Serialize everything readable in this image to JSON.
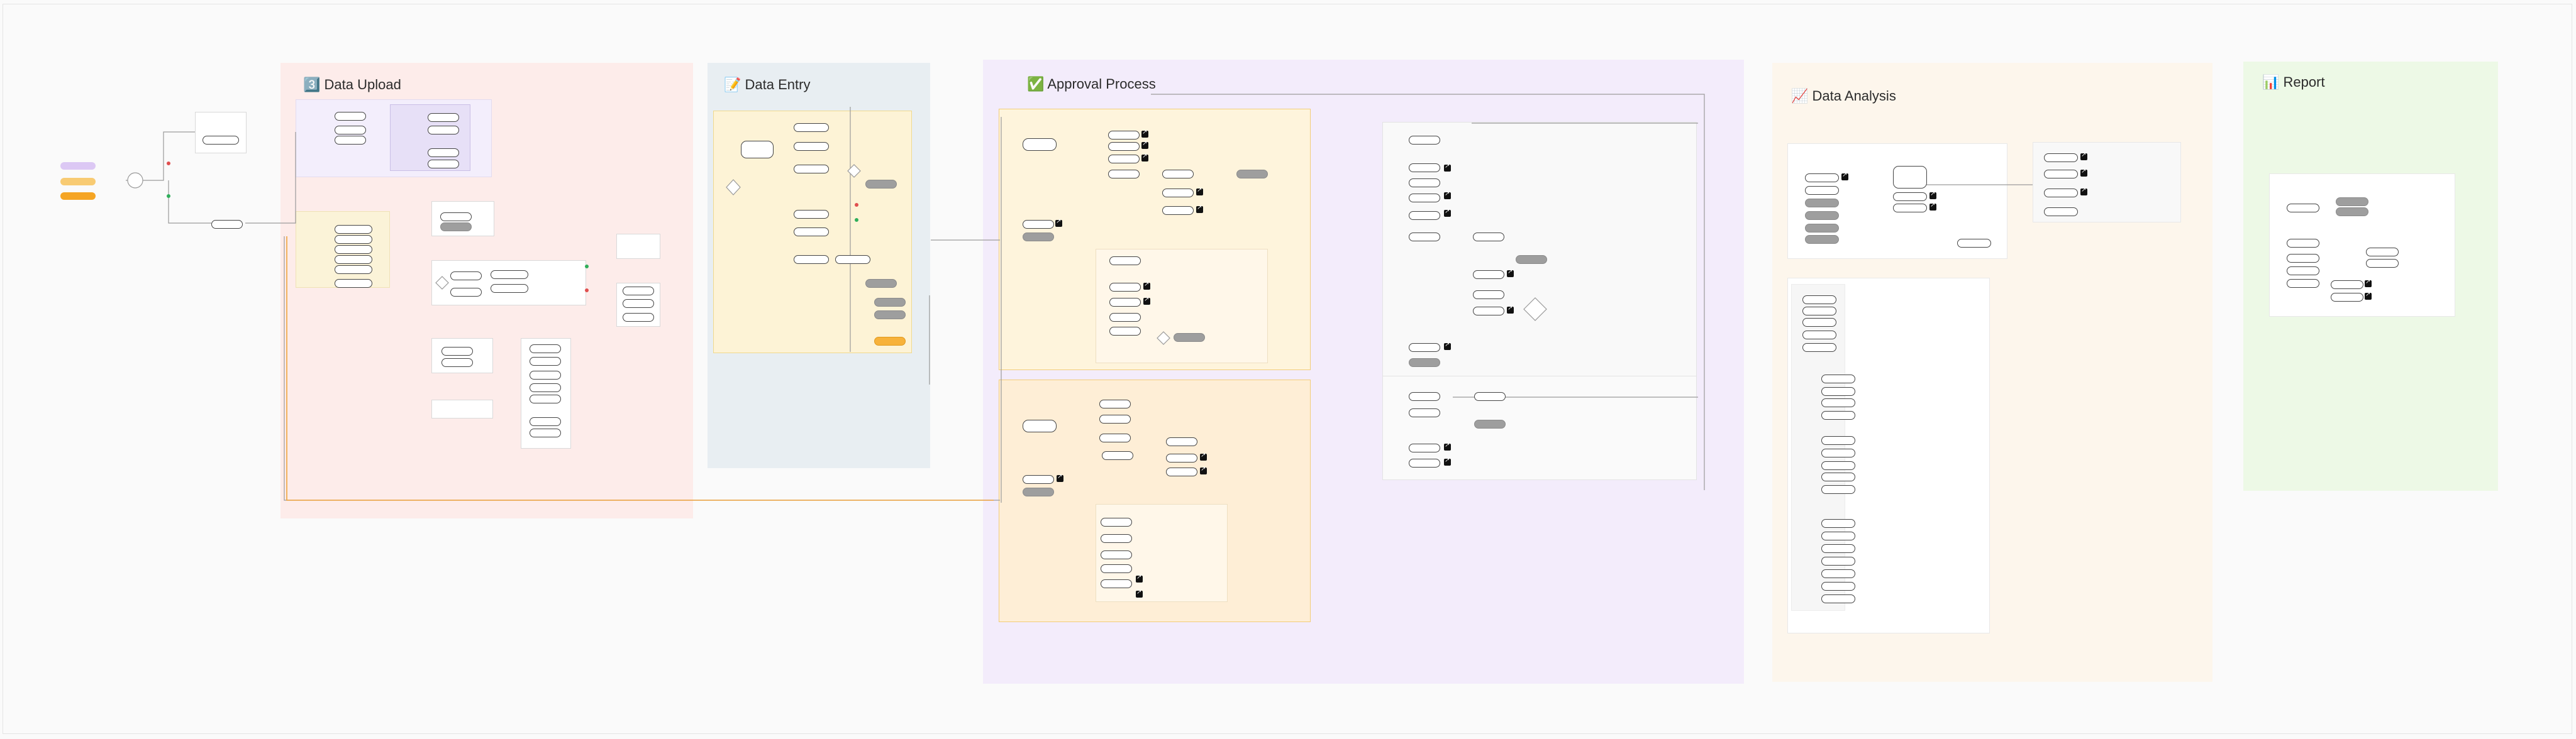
{
  "canvas": {
    "label": ""
  },
  "colors": {
    "upload_bg": "#fdecea",
    "entry_bg": "#e8eef2",
    "approval_bg": "#f3ecfb",
    "analysis_bg": "#fdf6ec",
    "report_bg": "#edf9e6",
    "grey_node": "#9e9e9e",
    "orange_node": "#f7b23b",
    "legend_purple": "#dcc8f4",
    "legend_orange_light": "#f8cb73",
    "legend_orange": "#f5a524"
  },
  "sections": {
    "upload": {
      "icon": "3️⃣",
      "title": "Data Upload"
    },
    "entry": {
      "icon": "📝",
      "title": "Data Entry"
    },
    "approval": {
      "icon": "✅",
      "title": "Approval Process"
    },
    "analysis": {
      "icon": "📈",
      "title": "Data Analysis"
    },
    "report": {
      "icon": "📊",
      "title": "Report"
    }
  }
}
